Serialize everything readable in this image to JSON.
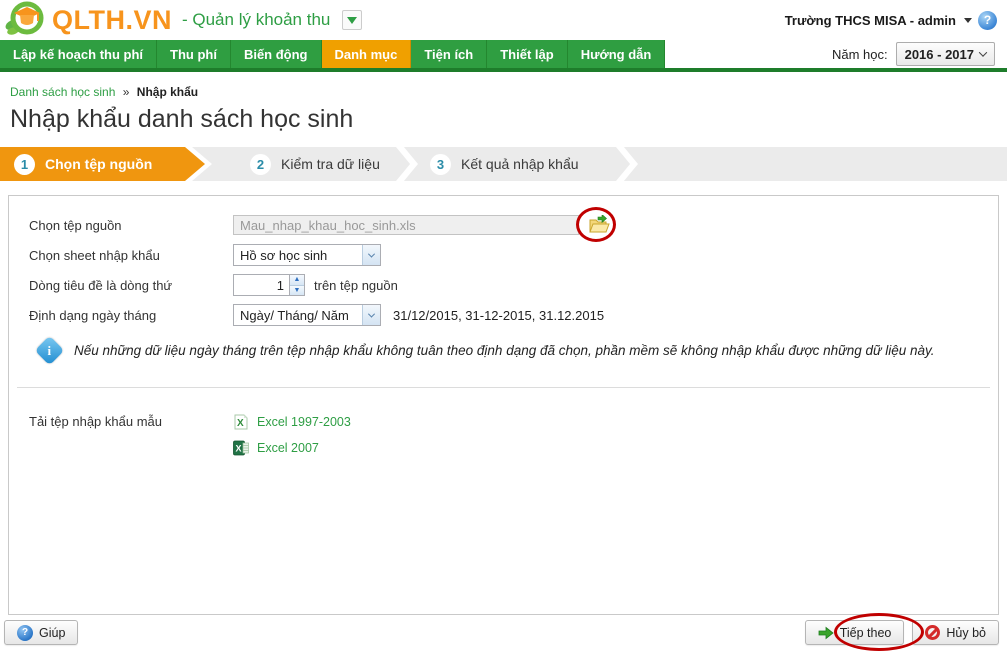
{
  "header": {
    "logo_text": "QLTH.VN",
    "logo_suffix": "- Quản lý khoản thu",
    "user": "Trường THCS MISA - admin"
  },
  "nav": {
    "items": [
      {
        "label": "Lập kế hoạch thu phí",
        "active": false
      },
      {
        "label": "Thu phí",
        "active": false
      },
      {
        "label": "Biến động",
        "active": false
      },
      {
        "label": "Danh mục",
        "active": true
      },
      {
        "label": "Tiện ích",
        "active": false
      },
      {
        "label": "Thiết lập",
        "active": false
      },
      {
        "label": "Hướng dẫn",
        "active": false
      }
    ],
    "school_year_label": "Năm học:",
    "school_year_value": "2016 - 2017"
  },
  "breadcrumb": {
    "parent": "Danh sách học sinh",
    "separator": "»",
    "current": "Nhập khẩu"
  },
  "page": {
    "title": "Nhập khẩu danh sách học sinh"
  },
  "wizard": {
    "steps": [
      {
        "num": "1",
        "label": "Chọn tệp nguồn",
        "active": true
      },
      {
        "num": "2",
        "label": "Kiểm tra dữ liệu",
        "active": false
      },
      {
        "num": "3",
        "label": "Kết quả nhập khẩu",
        "active": false
      }
    ]
  },
  "form": {
    "file": {
      "label": "Chọn tệp nguồn",
      "value": "Mau_nhap_khau_hoc_sinh.xls"
    },
    "sheet": {
      "label": "Chọn sheet nhập khẩu",
      "value": "Hồ sơ học sinh"
    },
    "header_row": {
      "label": "Dòng tiêu đề là dòng thứ",
      "value": "1",
      "suffix": "trên tệp nguồn"
    },
    "date_format": {
      "label": "Định dạng ngày tháng",
      "value": "Ngày/ Tháng/ Năm",
      "examples": "31/12/2015, 31-12-2015, 31.12.2015"
    },
    "note": "Nếu những dữ liệu ngày tháng trên tệp nhập khẩu không tuân theo định dạng đã chọn, phần mềm sẽ không nhập khẩu được những dữ liệu này.",
    "template": {
      "label": "Tải tệp nhập khẩu mẫu",
      "links": [
        {
          "label": "Excel 1997-2003"
        },
        {
          "label": "Excel 2007"
        }
      ]
    }
  },
  "footer": {
    "help_label": "Giúp",
    "next_label": "Tiếp theo",
    "cancel_label": "Hủy bỏ"
  },
  "icons": {
    "help_glyph": "?",
    "info_glyph": "i"
  },
  "colors": {
    "brand_green": "#2F9E41",
    "brand_orange": "#F7941D",
    "nav_active_orange": "#F0A000",
    "stripe_dark_green": "#1E7D2B",
    "wizard_step_orange": "#F0960F",
    "step_number_blue": "#2A8CA8",
    "link_green": "#2E9E44",
    "annotation_red": "#C00000"
  }
}
